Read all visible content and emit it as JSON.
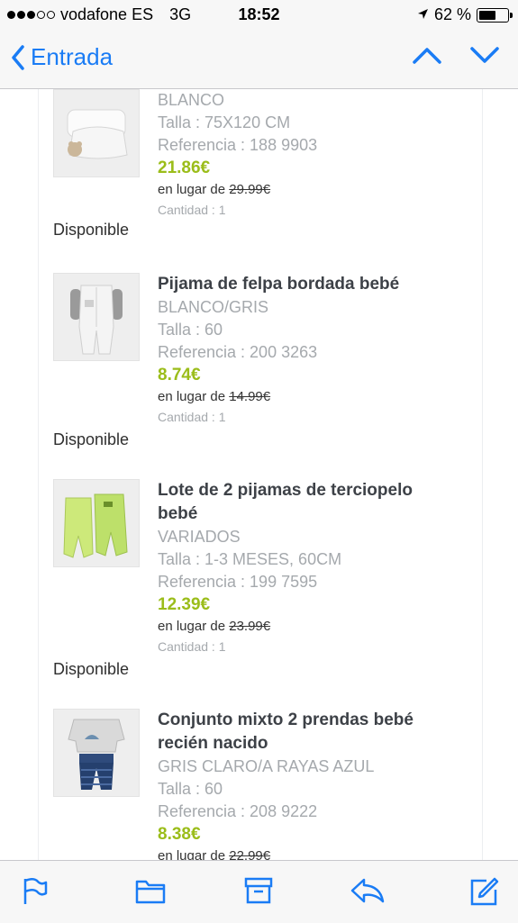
{
  "status_bar": {
    "carrier": "vodafone ES",
    "network": "3G",
    "time": "18:52",
    "battery": "62 %",
    "battery_level_pct": 62
  },
  "nav": {
    "back_label": "Entrada"
  },
  "items": [
    {
      "name": "",
      "color": "BLANCO",
      "size": "Talla : 75X120 CM",
      "reference": "Referencia : 188 9903",
      "price": "21.86€",
      "instead_prefix": "en lugar de",
      "original_price": "29.99€",
      "quantity": "Cantidad : 1",
      "availability": "Disponible"
    },
    {
      "name": "Pijama de felpa bordada bebé",
      "color": "BLANCO/GRIS",
      "size": "Talla : 60",
      "reference": "Referencia : 200 3263",
      "price": "8.74€",
      "instead_prefix": "en lugar de",
      "original_price": "14.99€",
      "quantity": "Cantidad : 1",
      "availability": "Disponible"
    },
    {
      "name_line1": "Lote de 2 pijamas de terciopelo",
      "name_line2": "bebé",
      "color": "VARIADOS",
      "size": "Talla : 1-3 MESES, 60CM",
      "reference": "Referencia : 199 7595",
      "price": "12.39€",
      "instead_prefix": "en lugar de",
      "original_price": "23.99€",
      "quantity": "Cantidad : 1",
      "availability": "Disponible"
    },
    {
      "name_line1": "Conjunto mixto 2 prendas bebé",
      "name_line2": "recién nacido",
      "color": "GRIS CLARO/A RAYAS AZUL",
      "size": "Talla : 60",
      "reference": "Referencia : 208 9222",
      "price": "8.38€",
      "instead_prefix": "en lugar de",
      "original_price": "22.99€"
    }
  ],
  "toolbar": {
    "icons": [
      "flag-icon",
      "folder-icon",
      "archive-icon",
      "reply-icon",
      "compose-icon"
    ]
  },
  "colors": {
    "accent": "#1a7cf5",
    "price": "#9bbd1a",
    "muted": "#a5a9ad"
  }
}
